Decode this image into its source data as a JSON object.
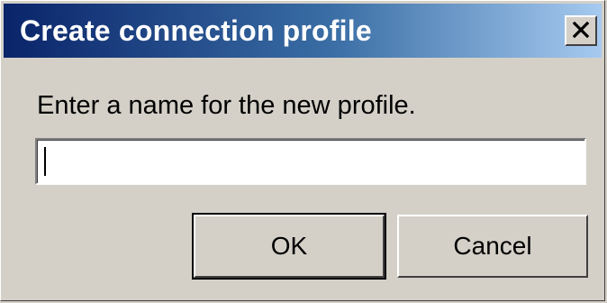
{
  "dialog": {
    "title": "Create connection profile",
    "prompt": "Enter a name for the new profile.",
    "name_input": {
      "value": "",
      "placeholder": ""
    },
    "ok_label": "OK",
    "cancel_label": "Cancel"
  },
  "icons": {
    "close": "close-icon"
  },
  "colors": {
    "titlebar_start": "#0a246a",
    "titlebar_end": "#a6caf0",
    "window_face": "#d4d0c8",
    "title_text": "#ffffff"
  }
}
